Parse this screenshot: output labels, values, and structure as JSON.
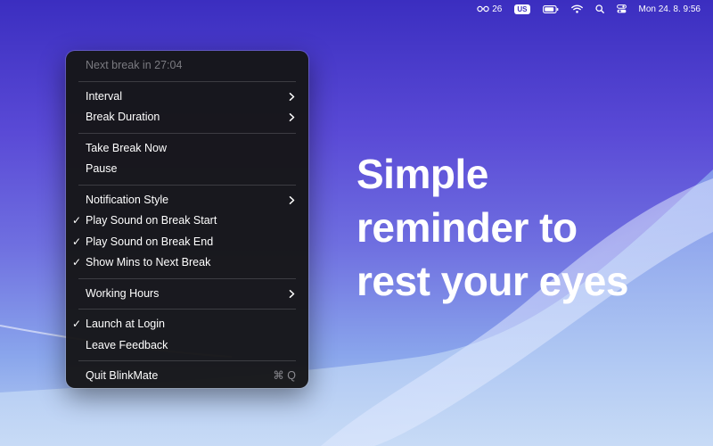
{
  "colors": {
    "menu_bg": "#161618",
    "text": "#ffffff",
    "disabled_text": "#7a7a80",
    "background_top": "#3b2ec0",
    "background_bottom": "#b9d0f2"
  },
  "menubar": {
    "items": [
      {
        "name": "glasses-status",
        "icon": "glasses-icon",
        "label": "26"
      },
      {
        "name": "input-source",
        "icon": "keyboard-icon",
        "label": "US"
      },
      {
        "name": "battery-status",
        "icon": "battery-icon",
        "label": ""
      },
      {
        "name": "wifi-status",
        "icon": "wifi-icon",
        "label": ""
      },
      {
        "name": "spotlight",
        "icon": "search-icon",
        "label": ""
      },
      {
        "name": "control-center",
        "icon": "control-center-icon",
        "label": ""
      }
    ],
    "clock": "Mon 24. 8.  9:56"
  },
  "menu": {
    "header": "Next break in 27:04",
    "items": [
      {
        "label": "Interval",
        "submenu": true
      },
      {
        "label": "Break Duration",
        "submenu": true
      },
      {
        "label": "Take Break Now"
      },
      {
        "label": "Pause"
      },
      {
        "label": "Notification Style",
        "submenu": true
      },
      {
        "label": "Play Sound on Break Start",
        "checked": true
      },
      {
        "label": "Play Sound on Break End",
        "checked": true
      },
      {
        "label": "Show Mins to Next Break",
        "checked": true
      },
      {
        "label": "Working Hours",
        "submenu": true
      },
      {
        "label": "Launch at Login",
        "checked": true
      },
      {
        "label": "Leave Feedback"
      },
      {
        "label": "Quit BlinkMate",
        "shortcut": "⌘ Q"
      }
    ],
    "check_glyph": "✓"
  },
  "headline": {
    "line1": "Simple",
    "line2": "reminder to",
    "line3": "rest your eyes"
  }
}
